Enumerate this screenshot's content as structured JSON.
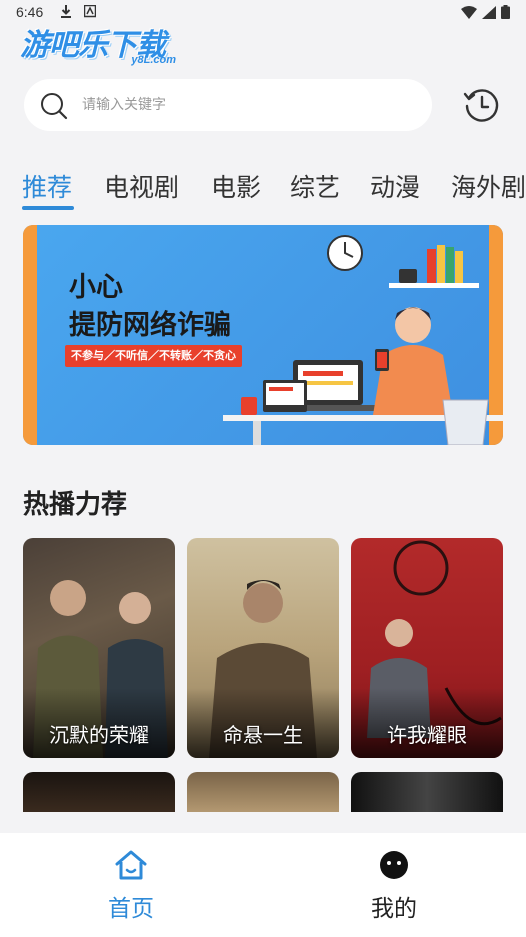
{
  "status_bar": {
    "time": "6:46"
  },
  "logo": {
    "title": "游吧乐下载",
    "subtitle": "y8L.com"
  },
  "search": {
    "placeholder": "请输入关键字"
  },
  "tabs": [
    {
      "label": "推荐",
      "active": true
    },
    {
      "label": "电视剧"
    },
    {
      "label": "电影"
    },
    {
      "label": "综艺"
    },
    {
      "label": "动漫"
    },
    {
      "label": "海外剧"
    }
  ],
  "banner": {
    "line1": "小心",
    "line2": "提防网络诈骗",
    "tagline": "不参与／不听信／不转账／不贪心"
  },
  "section": {
    "title": "热播力荐"
  },
  "cards": [
    {
      "title": "沉默的荣耀"
    },
    {
      "title": "命悬一生"
    },
    {
      "title": "许我耀眼"
    }
  ],
  "bottom_nav": [
    {
      "label": "首页",
      "icon": "home-icon",
      "active": true
    },
    {
      "label": "我的",
      "icon": "profile-face-icon"
    }
  ],
  "colors": {
    "accent": "#2e8ad8",
    "banner_bg": "#4aa7ef",
    "tag_red": "#e8402c"
  }
}
